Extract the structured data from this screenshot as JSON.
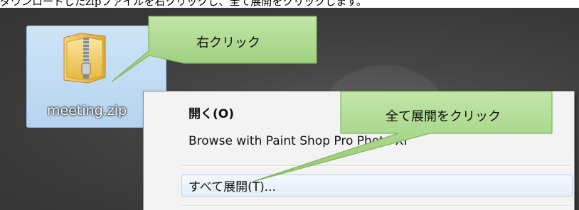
{
  "instruction_text": "ダウンロードしたzipファイルを右クリックし、全て展開をクリックします。",
  "file": {
    "name": "meeting.zip",
    "icon": "zip-folder-icon"
  },
  "context_menu": {
    "items": [
      {
        "label": "開く(O)",
        "bold": true
      },
      {
        "label": "Browse with Paint Shop Pro Photo XI",
        "bold": false
      },
      {
        "label": "すべて展開(T)...",
        "bold": false,
        "highlighted": true
      }
    ]
  },
  "callouts": [
    {
      "label": "右クリック"
    },
    {
      "label": "全て展開をクリック"
    }
  ],
  "colors": {
    "callout_fill": "#a6d78a",
    "callout_border": "#7fb55f",
    "selection": "#cde4f7"
  }
}
